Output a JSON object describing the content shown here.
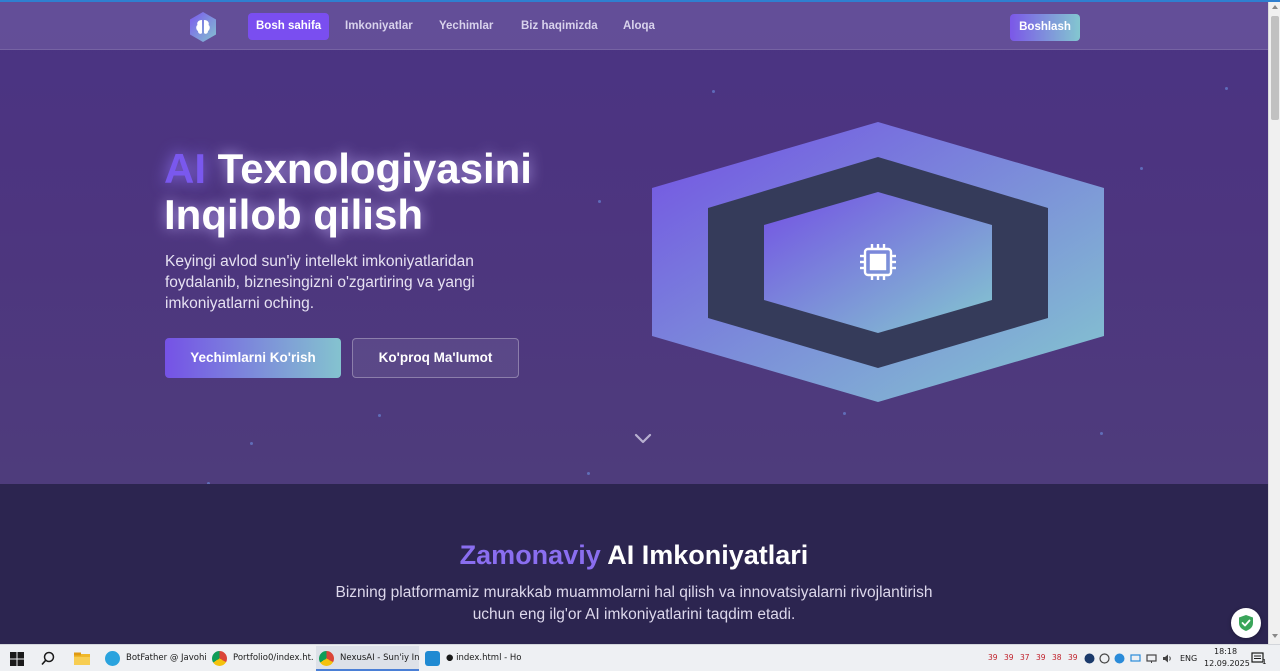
{
  "nav": {
    "items": [
      {
        "label": "Bosh sahifa",
        "active": true
      },
      {
        "label": "Imkoniyatlar",
        "active": false
      },
      {
        "label": "Yechimlar",
        "active": false
      },
      {
        "label": "Biz haqimizda",
        "active": false
      },
      {
        "label": "Aloqa",
        "active": false
      }
    ],
    "cta_label": "Boshlash"
  },
  "hero": {
    "title_highlight": "AI",
    "title_rest": "Texnologiyasini Inqilob qilish",
    "subtitle": "Keyingi avlod sun'iy intellekt imkoniyatlaridan foydalanib, biznesingizni o'zgartiring va yangi imkoniyatlarni oching.",
    "primary_button": "Yechimlarni Ko'rish",
    "secondary_button": "Ko'proq Ma'lumot",
    "center_icon": "chip-icon",
    "scroll_icon": "chevron-down-icon"
  },
  "features": {
    "title_highlight": "Zamonaviy",
    "title_rest": "AI Imkoniyatlari",
    "subtitle": "Bizning platformamiz murakkab muammolarni hal qilish va innovatsiyalarni rivojlantirish uchun eng ilg'or AI imkoniyatlarini taqdim etadi."
  },
  "taskbar": {
    "apps": [
      {
        "label": "BotFather @ Javohi...",
        "icon": "telegram-icon",
        "active": false
      },
      {
        "label": "Portfolio0/index.ht...",
        "icon": "chrome-icon",
        "active": false
      },
      {
        "label": "NexusAI - Sun'iy In...",
        "icon": "chrome-icon",
        "active": true
      },
      {
        "label": "● index.html - Hos...",
        "icon": "vscode-icon",
        "active": false
      }
    ],
    "tray_numbers": [
      "39",
      "39",
      "37",
      "39",
      "38",
      "39"
    ],
    "language": "ENG",
    "time": "18:18",
    "date": "12.09.2025",
    "notification_count": "1"
  },
  "colors": {
    "accent": "#7a4ef0",
    "gradient_end": "#84c3cf",
    "hero_bg": "#4a3383",
    "section_bg": "#2c2550"
  }
}
